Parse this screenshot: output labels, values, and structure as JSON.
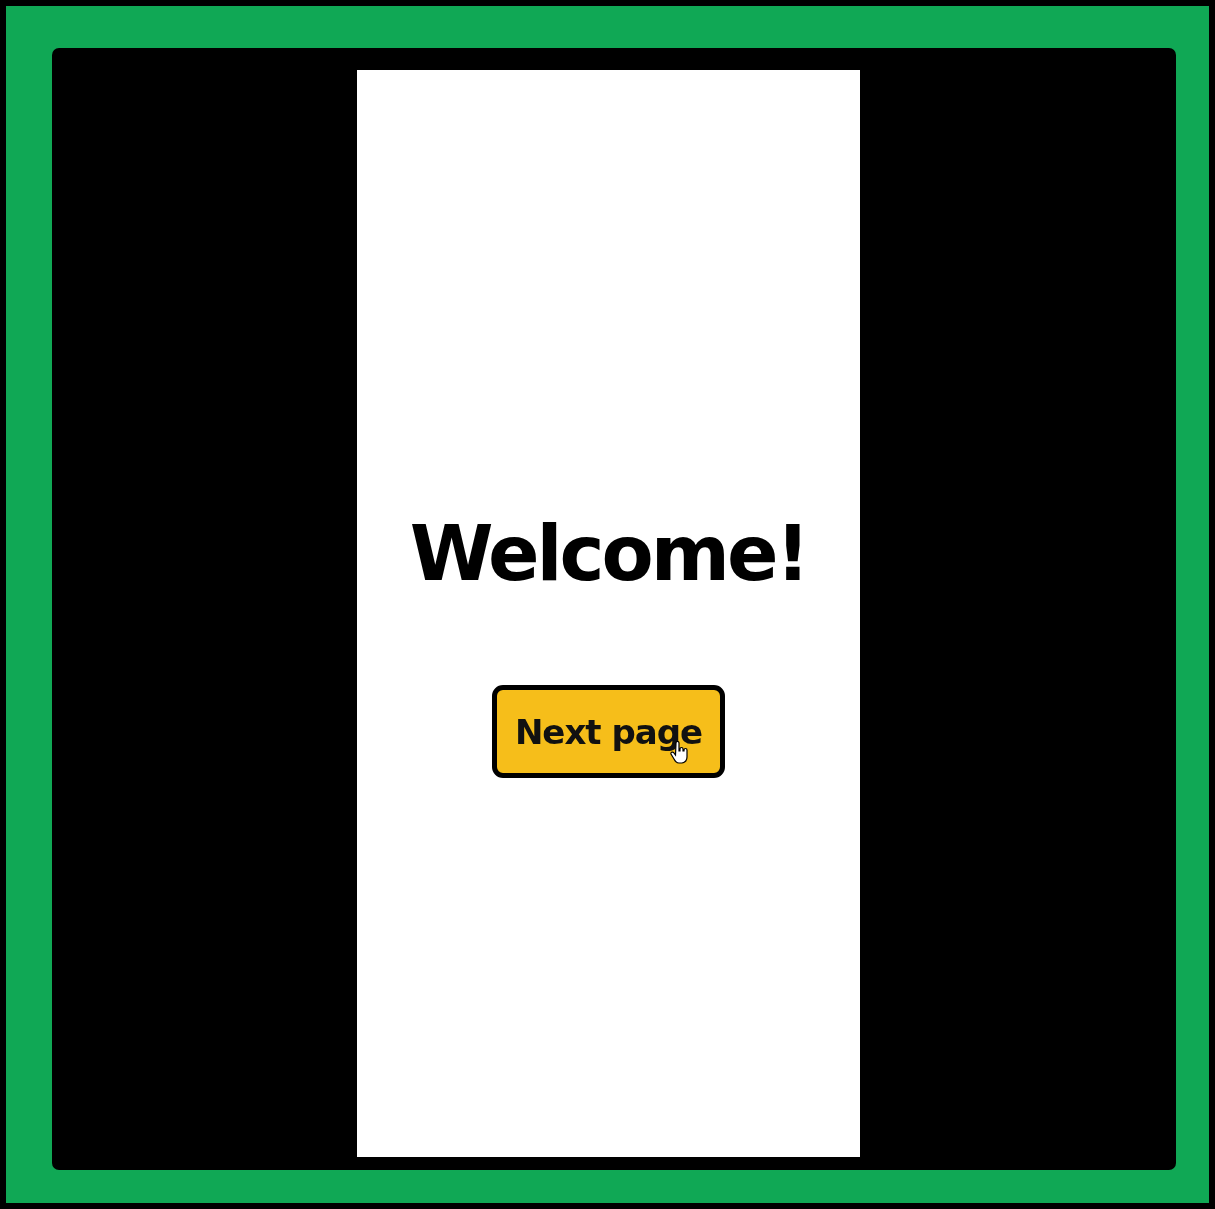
{
  "screen": {
    "title": "Welcome!",
    "button": {
      "label": "Next page"
    }
  }
}
